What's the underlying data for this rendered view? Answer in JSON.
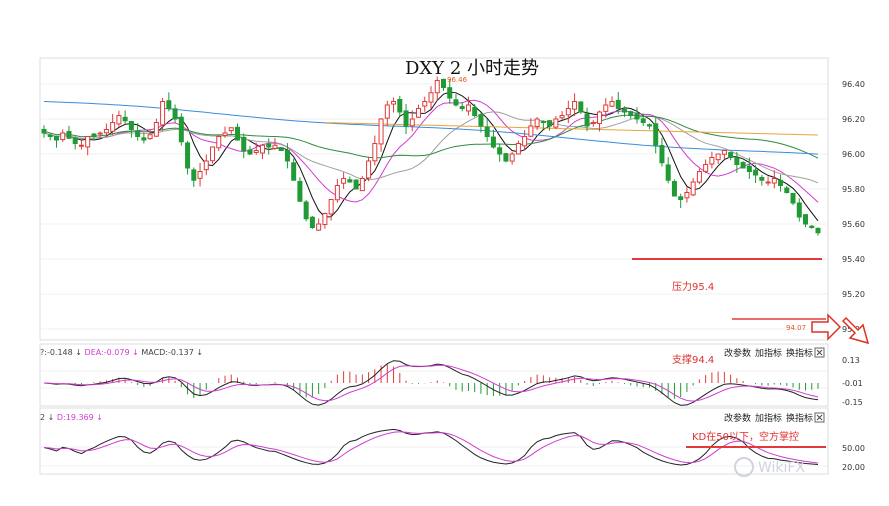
{
  "title": "DXY 2 小时走势",
  "colors": {
    "up": "#e03a3a",
    "down": "#1f9a34",
    "ma_black": "#111111",
    "ma_magenta": "#d13cd1",
    "ma_gray": "#a0a0a0",
    "ma_green": "#2e8b3e",
    "ma_blue": "#3a8ed8",
    "ma_orange": "#e8a43a",
    "support": "#e23a3a",
    "arrow": "#e03020",
    "grid": "#e6e6e6"
  },
  "chart_data": [
    {
      "type": "candlestick",
      "yticks": [
        "96.40",
        "96.20",
        "96.00",
        "95.80",
        "95.60",
        "95.40",
        "95.20",
        "95.00"
      ],
      "ylim": [
        94.95,
        96.5
      ],
      "price_labels": {
        "high": "96.46",
        "low": "94.07"
      },
      "close_path": [
        96.12,
        96.1,
        96.08,
        96.12,
        96.09,
        96.06,
        96.05,
        96.1,
        96.1,
        96.12,
        96.14,
        96.18,
        96.22,
        96.19,
        96.14,
        96.1,
        96.08,
        96.11,
        96.18,
        96.3,
        96.26,
        96.2,
        96.07,
        95.92,
        95.85,
        95.9,
        95.96,
        96.04,
        96.1,
        96.12,
        96.15,
        96.08,
        96.02,
        96.0,
        96.02,
        96.05,
        96.04,
        96.05,
        96.02,
        95.96,
        95.85,
        95.73,
        95.63,
        95.58,
        95.6,
        95.66,
        95.74,
        95.82,
        95.86,
        95.84,
        95.8,
        95.86,
        95.96,
        96.06,
        96.2,
        96.28,
        96.3,
        96.24,
        96.16,
        96.2,
        96.26,
        96.3,
        96.35,
        96.42,
        96.38,
        96.32,
        96.28,
        96.26,
        96.28,
        96.22,
        96.16,
        96.1,
        96.04,
        96.0,
        95.96,
        96.0,
        96.06,
        96.1,
        96.16,
        96.2,
        96.18,
        96.16,
        96.2,
        96.22,
        96.26,
        96.3,
        96.24,
        96.16,
        96.18,
        96.24,
        96.28,
        96.3,
        96.26,
        96.24,
        96.22,
        96.2,
        96.18,
        96.16,
        96.05,
        95.95,
        95.85,
        95.76,
        95.74,
        95.78,
        95.84,
        95.9,
        95.94,
        95.98,
        96.0,
        96.02,
        95.98,
        95.94,
        95.92,
        95.9,
        95.88,
        95.85,
        95.84,
        95.86,
        95.82,
        95.78,
        95.72,
        95.64,
        95.6,
        95.58,
        95.55
      ],
      "annotations": [
        "压力95.4",
        "支撑94.4"
      ]
    },
    {
      "type": "macd",
      "label_parts": [
        {
          "text": "?:-0.148",
          "color": "#444444"
        },
        {
          "text": "↓",
          "color": "#444444"
        },
        {
          "text": "DEA:-0.079",
          "color": "#d13cd1"
        },
        {
          "text": "↓",
          "color": "#d13cd1"
        },
        {
          "text": "MACD:-0.137",
          "color": "#444444"
        },
        {
          "text": "↓",
          "color": "#444444"
        }
      ],
      "yticks": [
        "0.13",
        "-0.01",
        "-0.15"
      ],
      "buttons": [
        "改参数",
        "加指标",
        "换指标"
      ]
    },
    {
      "type": "kd",
      "label_parts": [
        {
          "text": "2",
          "color": "#444444"
        },
        {
          "text": "↓",
          "color": "#444444"
        },
        {
          "text": "D:19.369",
          "color": "#d13cd1"
        },
        {
          "text": "↓",
          "color": "#d13cd1"
        }
      ],
      "yticks": [
        "50.00",
        "20.00"
      ],
      "buttons": [
        "改参数",
        "加指标",
        "换指标"
      ],
      "annotation": "KD在50以下，空方掌控"
    }
  ],
  "watermark": "WikiFX"
}
